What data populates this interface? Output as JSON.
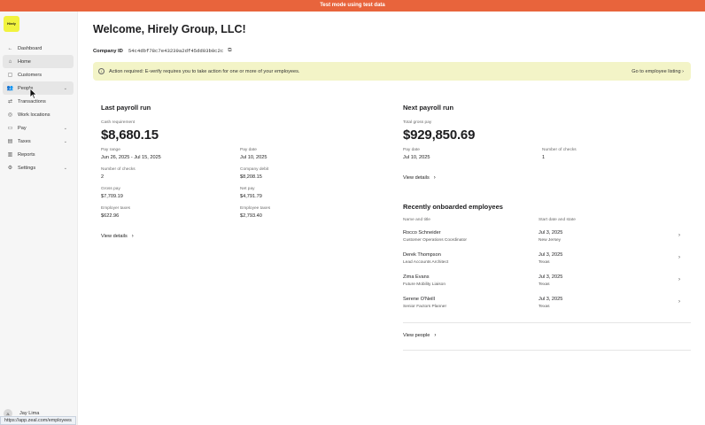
{
  "banner": {
    "text": "Test mode using test data"
  },
  "brand": {
    "logo_text": "Hirely"
  },
  "sidebar": {
    "items": [
      {
        "label": "Dashboard",
        "icon": "back-arrow-icon"
      },
      {
        "label": "Home",
        "icon": "home-icon"
      },
      {
        "label": "Customers",
        "icon": "customers-icon"
      },
      {
        "label": "People",
        "icon": "people-icon"
      },
      {
        "label": "Transactions",
        "icon": "transactions-icon"
      },
      {
        "label": "Work locations",
        "icon": "location-icon"
      },
      {
        "label": "Pay",
        "icon": "pay-icon"
      },
      {
        "label": "Taxes",
        "icon": "taxes-icon"
      },
      {
        "label": "Reports",
        "icon": "reports-icon"
      },
      {
        "label": "Settings",
        "icon": "settings-icon"
      }
    ],
    "user_name": "Jay Lima",
    "user_initial": "JL"
  },
  "status_bar": {
    "url": "https://app.zeal.com/employees"
  },
  "page": {
    "title": "Welcome, Hirely Group, LLC!",
    "company_id_label": "Company ID",
    "company_id": "54c4dbf78c7e43239a2df45dd03b0c2c"
  },
  "alert": {
    "message": "Action required: E-verify requires you to take action for one or more of your employees.",
    "link": "Go to employee listing"
  },
  "last_payroll": {
    "title": "Last payroll run",
    "cash_requirement_label": "Cash requirement",
    "cash_requirement": "$8,680.15",
    "pay_range_label": "Pay range",
    "pay_range": "Jun 26, 2025 - Jul 15, 2025",
    "pay_date_label": "Pay date",
    "pay_date": "Jul 10, 2025",
    "checks_label": "Number of checks",
    "checks": "2",
    "company_debit_label": "Company debit",
    "company_debit": "$8,208.15",
    "gross_pay_label": "Gross pay",
    "gross_pay": "$7,709.19",
    "net_pay_label": "Net pay",
    "net_pay": "$4,791.79",
    "employer_taxes_label": "Employer taxes",
    "employer_taxes": "$622.96",
    "employee_taxes_label": "Employee taxes",
    "employee_taxes": "$2,793.40",
    "view_details": "View details"
  },
  "next_payroll": {
    "title": "Next payroll run",
    "gross_label": "Total gross pay",
    "gross": "$929,850.69",
    "pay_date_label": "Pay date",
    "pay_date": "Jul 10, 2025",
    "checks_label": "Number of checks",
    "checks": "1",
    "view_details": "View details"
  },
  "recent": {
    "title": "Recently onboarded employees",
    "col_name": "Name and title",
    "col_start": "Start date and state",
    "employees": [
      {
        "name": "Rocco Schneider",
        "title": "Customer Operations Coordinator",
        "date": "Jul 3, 2025",
        "state": "New Jersey"
      },
      {
        "name": "Derek Thompson",
        "title": "Lead Accounts Architect",
        "date": "Jul 3, 2025",
        "state": "Texas"
      },
      {
        "name": "Zima Evans",
        "title": "Future Mobility Liaison",
        "date": "Jul 3, 2025",
        "state": "Texas"
      },
      {
        "name": "Serene O'Neill",
        "title": "Senior Factors Planner",
        "date": "Jul 3, 2025",
        "state": "Texas"
      }
    ],
    "view_people": "View people"
  },
  "colors": {
    "banner": "#e8643c",
    "alert_bg": "#f3f4c7",
    "logo": "#f1f33e"
  }
}
